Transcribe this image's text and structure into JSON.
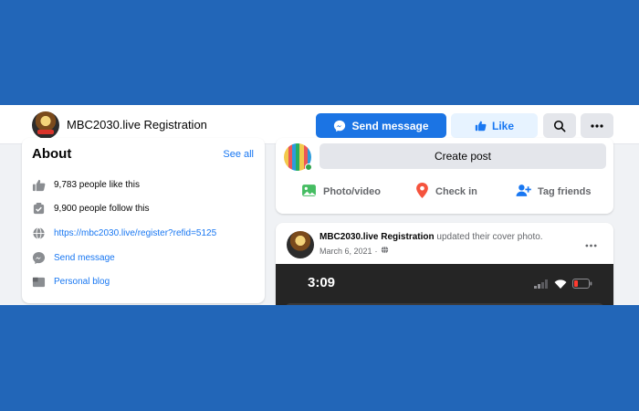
{
  "header": {
    "page_name": "MBC2030.live Registration",
    "send_message_label": "Send message",
    "like_label": "Like"
  },
  "about": {
    "title": "About",
    "see_all": "See all",
    "items": [
      {
        "icon": "thumbs-up-icon",
        "text": "9,783 people like this"
      },
      {
        "icon": "follow-icon",
        "text": "9,900 people follow this"
      },
      {
        "icon": "globe-icon",
        "text": "https://mbc2030.live/register?refid=5125"
      },
      {
        "icon": "messenger-icon",
        "text": "Send message"
      },
      {
        "icon": "blog-icon",
        "text": "Personal blog"
      }
    ]
  },
  "composer": {
    "create_post": "Create post",
    "actions": [
      {
        "label": "Photo/video",
        "icon": "photo-icon",
        "color": "#45bd62"
      },
      {
        "label": "Check in",
        "icon": "location-pin-icon",
        "color": "#f5533d"
      },
      {
        "label": "Tag friends",
        "icon": "tag-friends-icon",
        "color": "#1877f2"
      }
    ]
  },
  "post": {
    "author": "MBC2030.live Registration",
    "action_text": "updated their cover photo.",
    "date": "March 6, 2021",
    "separator": "·",
    "cover": {
      "time": "3:09"
    }
  },
  "colors": {
    "background": "#2266b8",
    "brand_blue": "#1877f2",
    "page_bg": "#f0f2f5"
  }
}
